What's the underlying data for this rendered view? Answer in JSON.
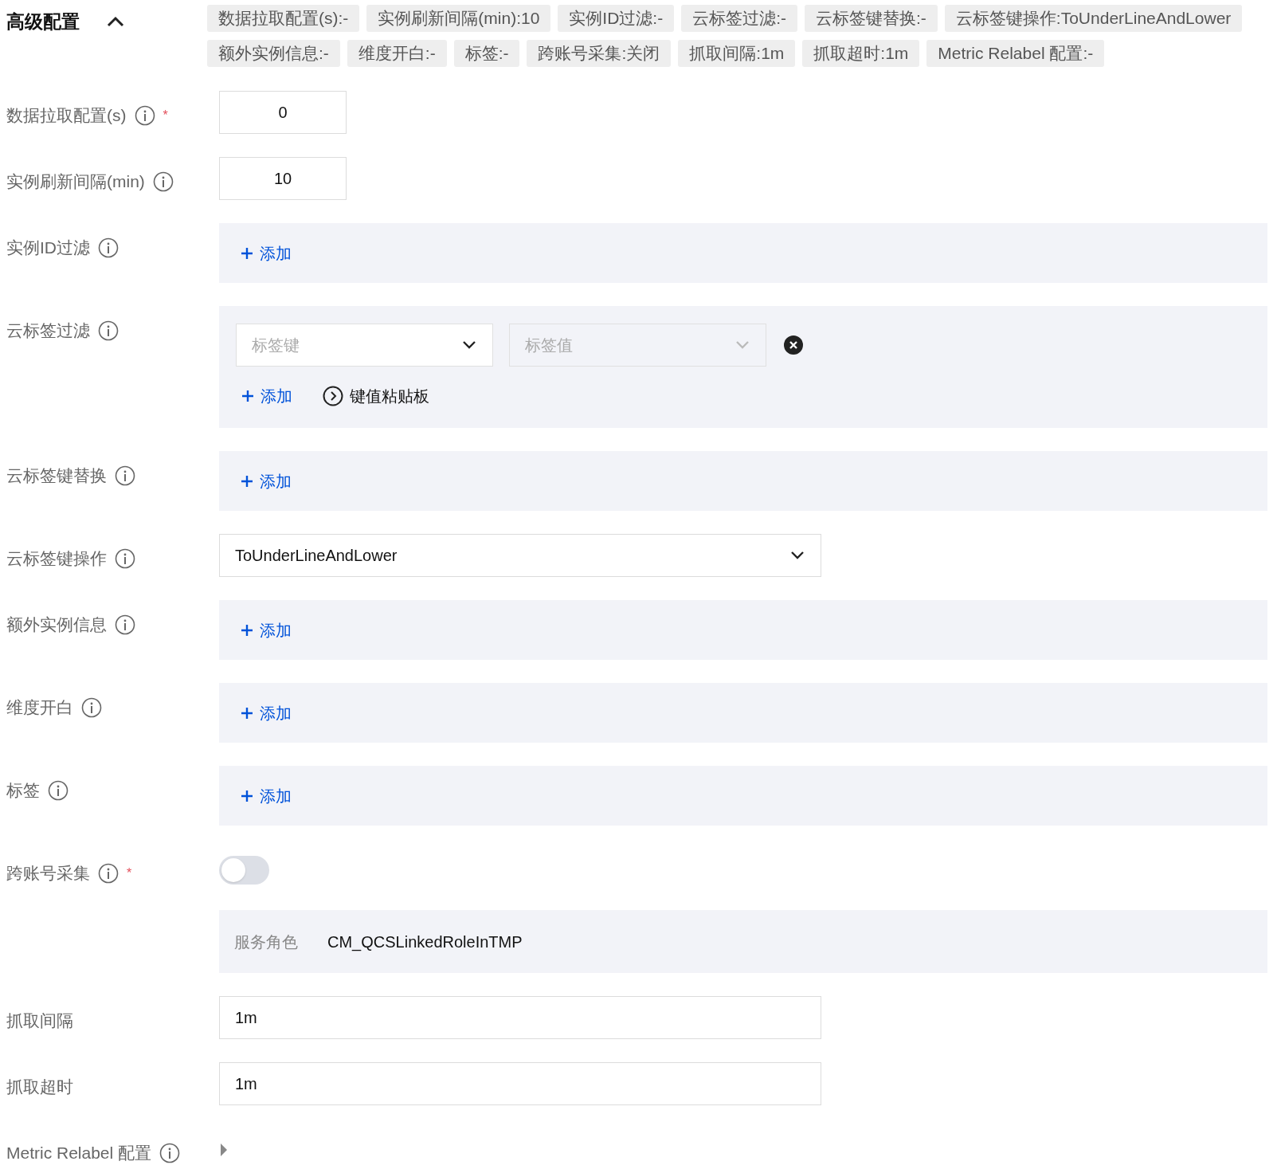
{
  "header": {
    "title": "高级配置",
    "expanded": true
  },
  "summary": [
    "数据拉取配置(s):-",
    "实例刷新间隔(min):10",
    "实例ID过滤:-",
    "云标签过滤:-",
    "云标签键替换:-",
    "云标签键操作:ToUnderLineAndLower",
    "额外实例信息:-",
    "维度开白:-",
    "标签:-",
    "跨账号采集:关闭",
    "抓取间隔:1m",
    "抓取超时:1m",
    "Metric Relabel 配置:-"
  ],
  "fields": [
    {
      "label": "数据拉取配置(s)",
      "info": true,
      "required_mark": "*",
      "kind": "number",
      "value": "0"
    },
    {
      "label": "实例刷新间隔(min)",
      "info": true,
      "kind": "number",
      "value": "10"
    },
    {
      "label": "实例ID过滤",
      "info": true,
      "kind": "add",
      "add_label": "添加"
    },
    {
      "label": "云标签过滤",
      "info": true,
      "kind": "tag_filter",
      "key_placeholder": "标签键",
      "value_placeholder": "标签值",
      "value_disabled": true,
      "add_label": "添加",
      "clipboard_label": "键值粘贴板"
    },
    {
      "label": "云标签键替换",
      "info": true,
      "kind": "add",
      "add_label": "添加"
    },
    {
      "label": "云标签键操作",
      "info": true,
      "kind": "select",
      "value": "ToUnderLineAndLower"
    },
    {
      "label": "额外实例信息",
      "info": true,
      "kind": "add",
      "add_label": "添加"
    },
    {
      "label": "维度开白",
      "info": true,
      "kind": "add",
      "add_label": "添加"
    },
    {
      "label": "标签",
      "info": true,
      "kind": "add",
      "add_label": "添加"
    },
    {
      "label": "跨账号采集",
      "info": true,
      "required_mark": "*",
      "kind": "switch",
      "on": false,
      "role_label": "服务角色",
      "role_value": "CM_QCSLinkedRoleInTMP"
    },
    {
      "label": "抓取间隔",
      "info": false,
      "kind": "text",
      "value": "1m"
    },
    {
      "label": "抓取超时",
      "info": false,
      "kind": "text",
      "value": "1m"
    },
    {
      "label": "Metric Relabel 配置",
      "info": true,
      "kind": "collapse",
      "expanded": false
    }
  ]
}
